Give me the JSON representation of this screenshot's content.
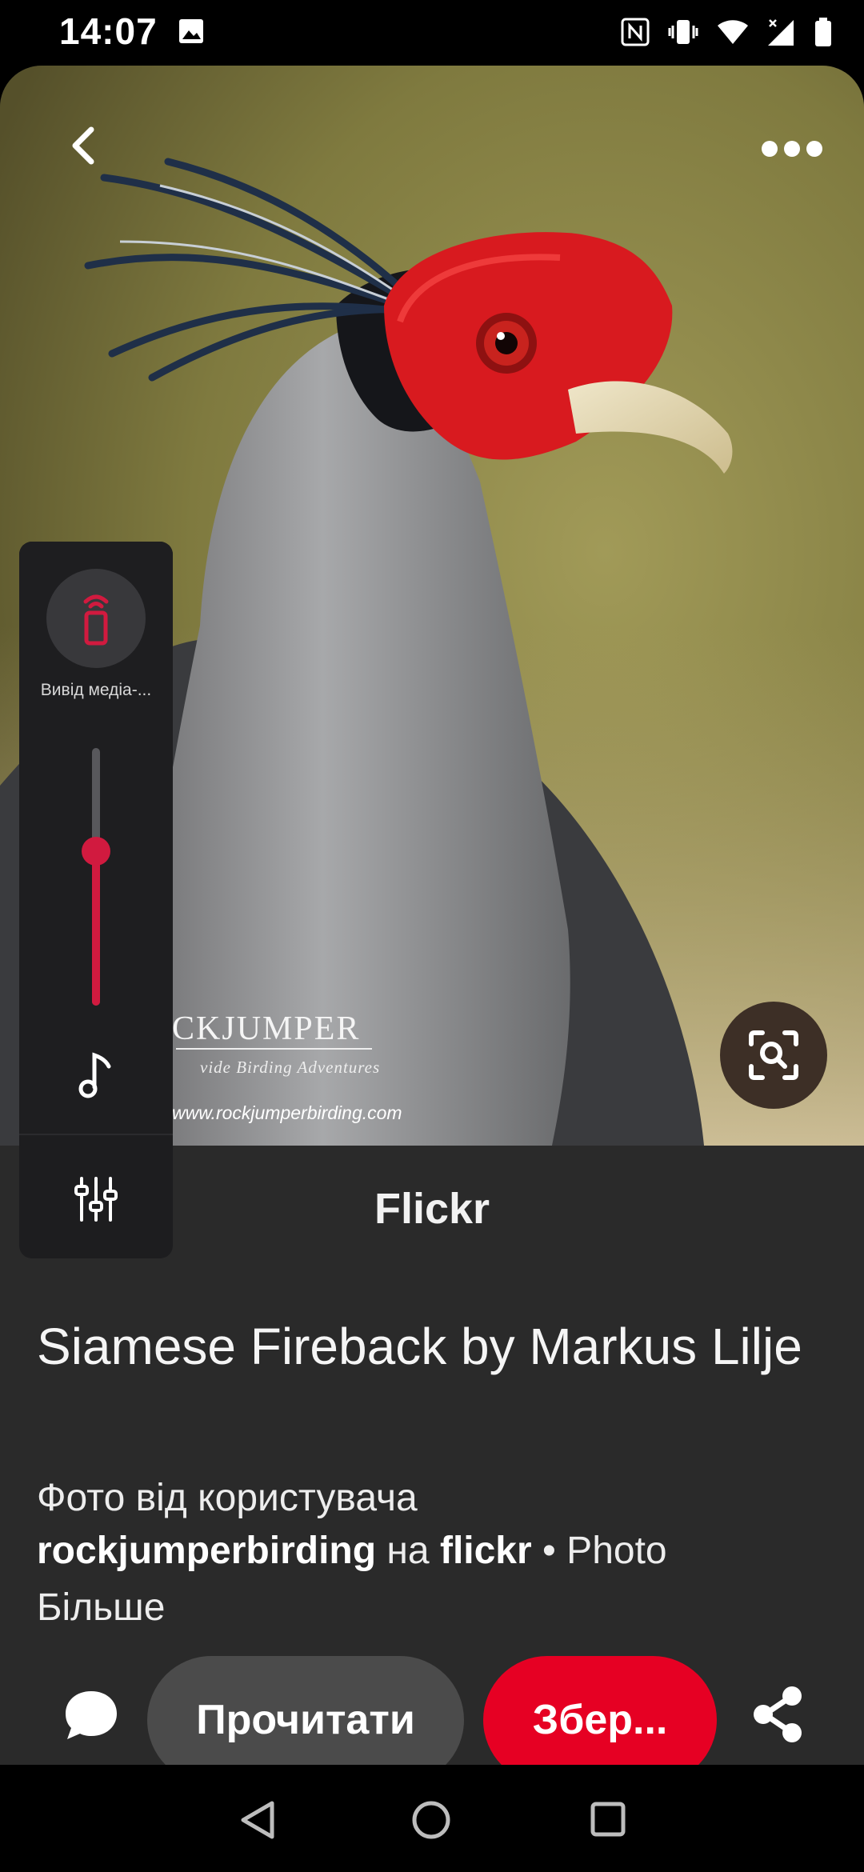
{
  "status_bar": {
    "time": "14:07",
    "icons": [
      "gallery-icon",
      "nfc-icon",
      "vibrate-icon",
      "wifi-icon",
      "signal-icon",
      "battery-icon"
    ]
  },
  "pin": {
    "source": "Flickr",
    "title": "Siamese Fireback by Markus Lilje",
    "description_prefix": "Фото від користувача",
    "author": "rockjumperbirding",
    "description_connector": "на",
    "site": "flickr",
    "description_suffix": "• Photo",
    "more_label": "Більше"
  },
  "image": {
    "watermark_brand": "CKJUMPER",
    "watermark_tagline": "vide Birding Adventures",
    "watermark_url": "www.rockjumperbirding.com"
  },
  "actions": {
    "read_label": "Прочитати",
    "save_label": "Збер...",
    "save_color": "#e60023"
  },
  "volume_panel": {
    "media_output_label": "Вивід медіа-...",
    "level_fraction": 0.6,
    "accent_color": "#d11a3f"
  }
}
